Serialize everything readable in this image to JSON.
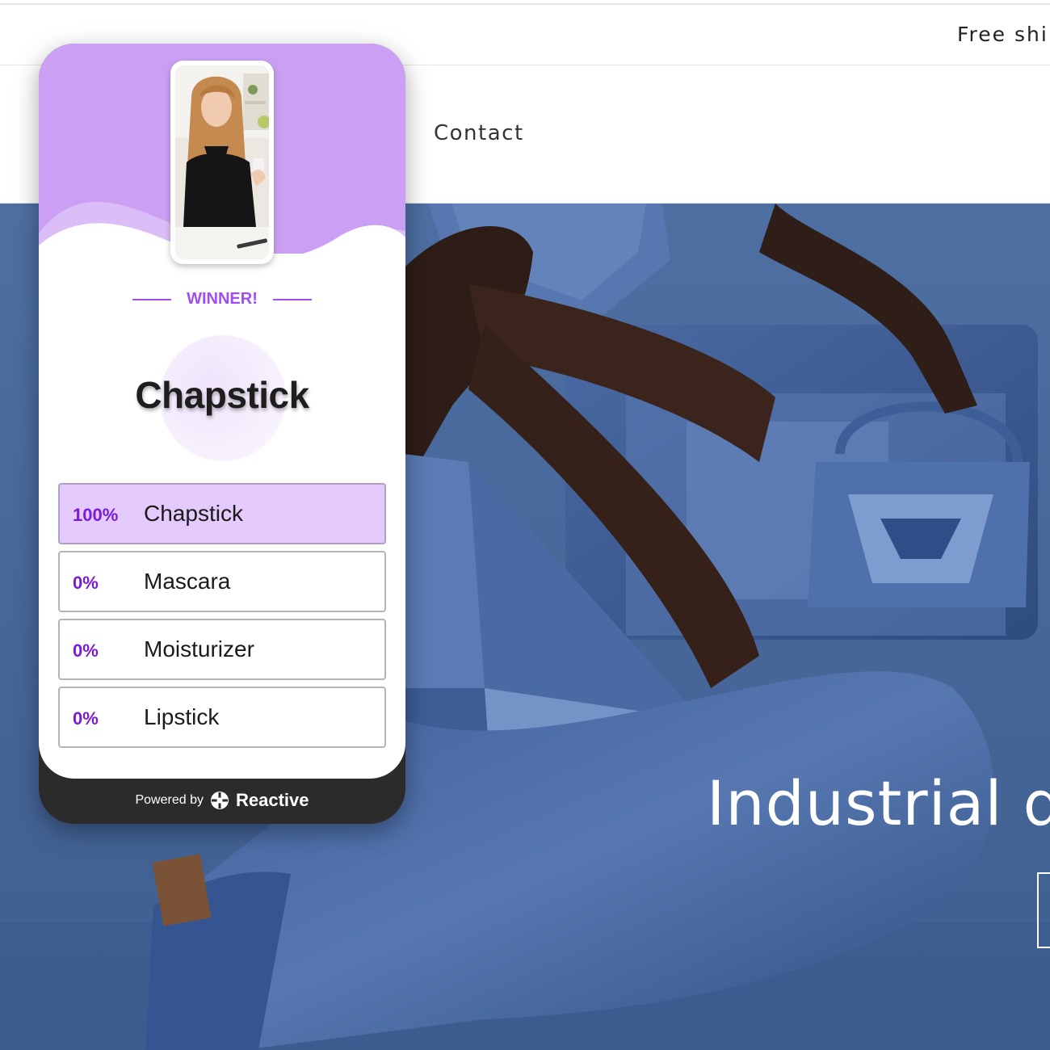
{
  "store": {
    "announcement": "Free ship",
    "nav": {
      "contact": "Contact"
    },
    "hero": {
      "heading": "Industrial de"
    }
  },
  "widget": {
    "label": "WINNER!",
    "winner": "Chapstick",
    "options": [
      {
        "percent": "100%",
        "label": "Chapstick",
        "value": 100
      },
      {
        "percent": "0%",
        "label": "Mascara",
        "value": 0
      },
      {
        "percent": "0%",
        "label": "Moisturizer",
        "value": 0
      },
      {
        "percent": "0%",
        "label": "Lipstick",
        "value": 0
      }
    ],
    "footer": {
      "powered_by": "Powered by",
      "brand": "Reactive"
    },
    "colors": {
      "accent": "#a24df0",
      "header_bg": "#cba0f4",
      "winner_fill": "#e4cafd",
      "footer_bg": "#2b2b2b"
    }
  },
  "icons": {
    "brand_logo": "reactive-logo-icon",
    "video_thumbnail": "video-thumbnail"
  }
}
